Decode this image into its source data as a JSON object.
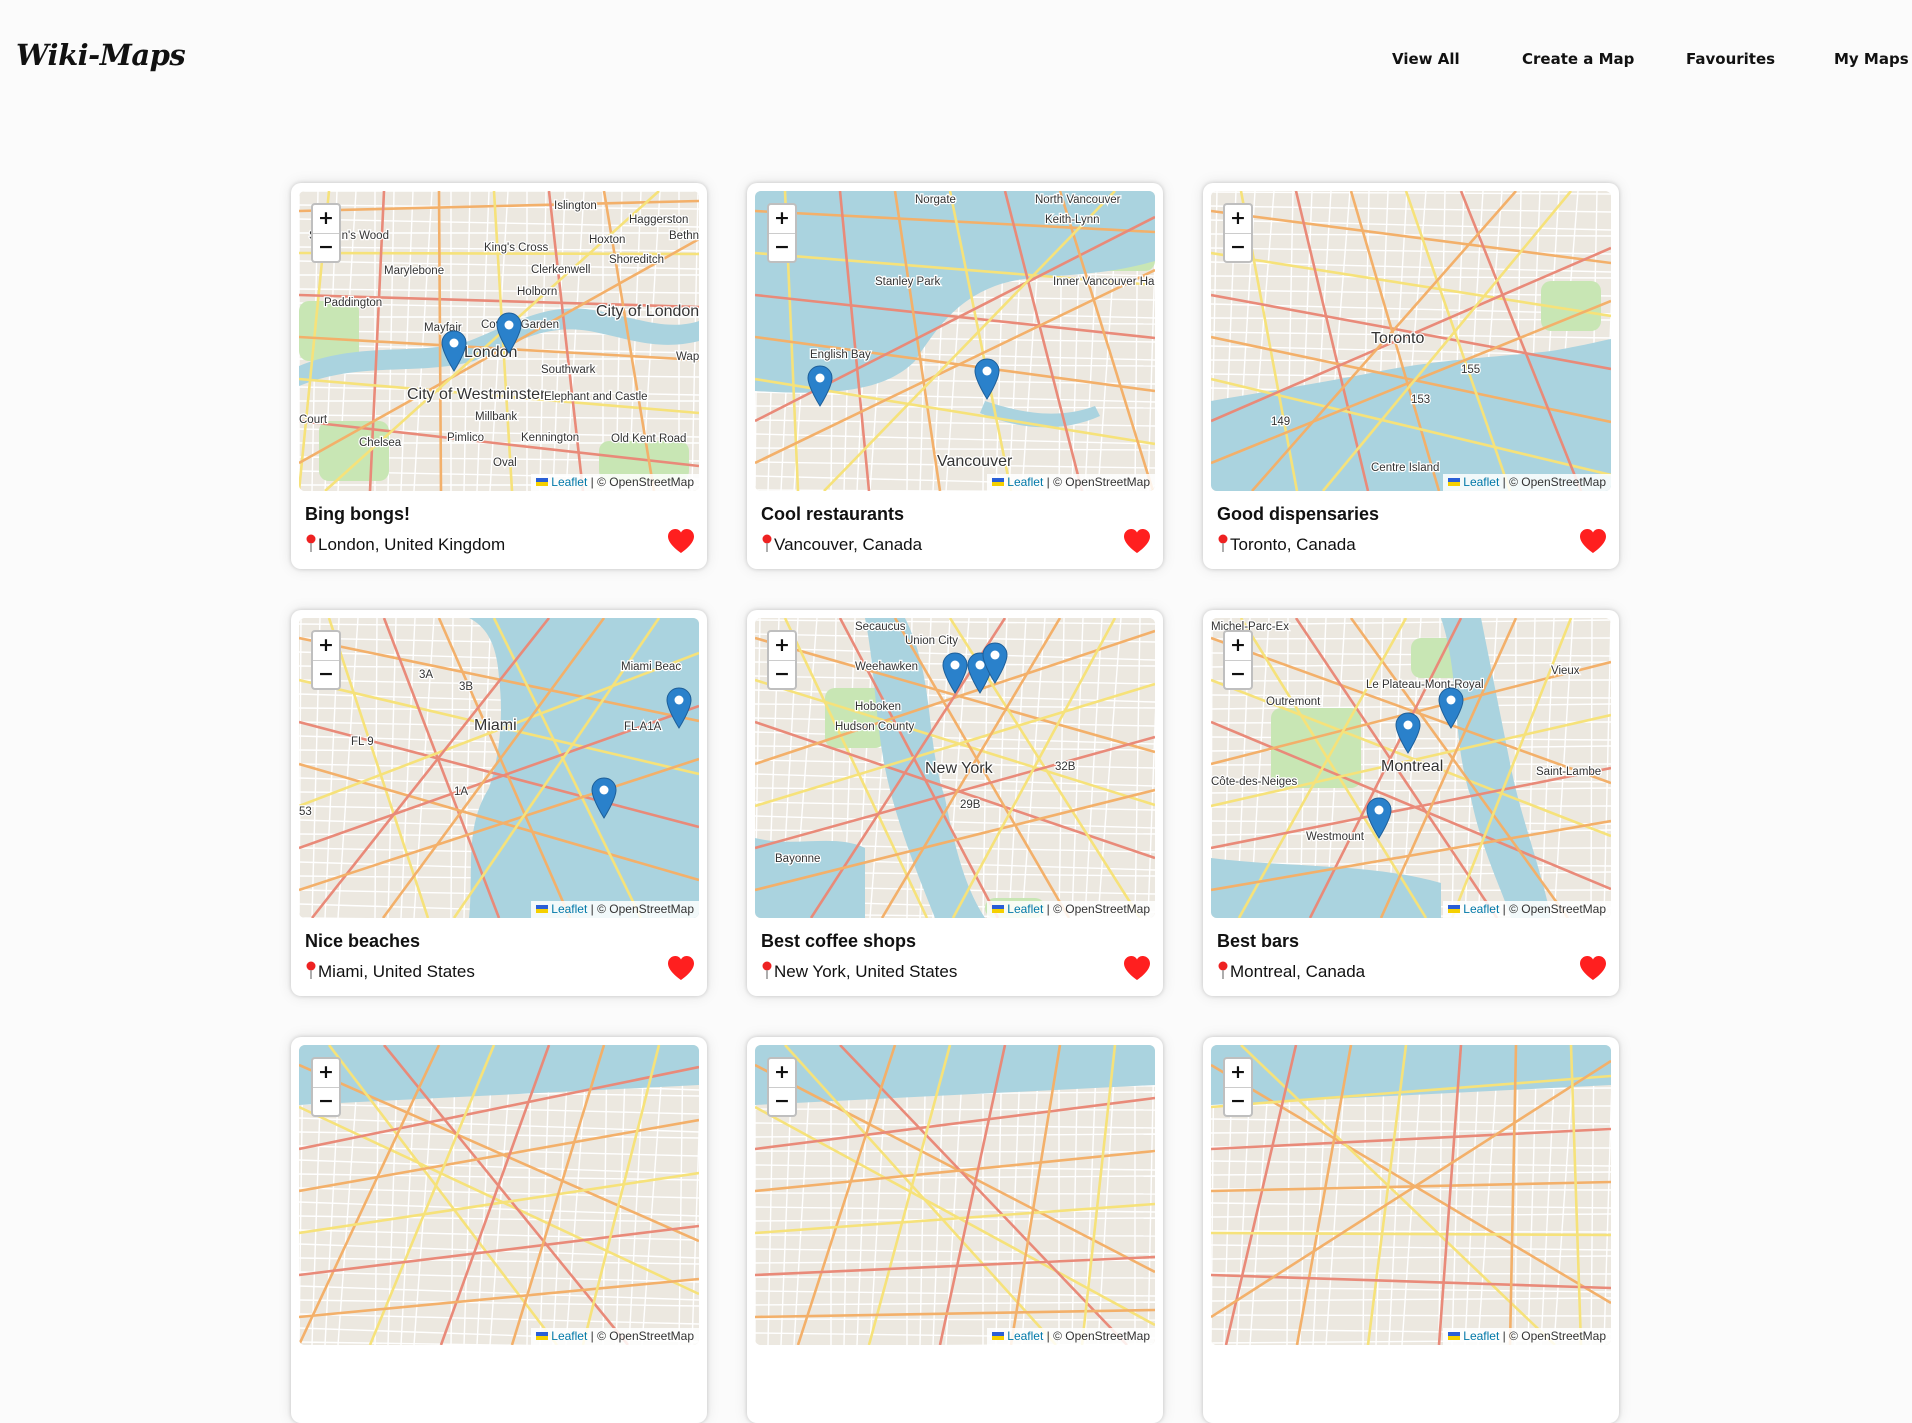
{
  "header": {
    "logo": "Wiki-Maps",
    "nav": [
      {
        "label": "View All"
      },
      {
        "label": "Create a Map"
      },
      {
        "label": "Favourites"
      },
      {
        "label": "My Maps"
      }
    ]
  },
  "map_common": {
    "zoom_in": "+",
    "zoom_out": "−",
    "attribution_link": "Leaflet",
    "attribution_text": "| © OpenStreetMap",
    "favourite_icon": "heart-icon",
    "location_icon": "red-pin-icon"
  },
  "colors": {
    "marker": "#2a81cb",
    "heart": "#ff1f1f",
    "water": "#aad3df",
    "park": "#c8e6b4",
    "land": "#ece8e0"
  },
  "cards": [
    {
      "title": "Bing bongs!",
      "location": "London, United Kingdom",
      "map_labels": [
        "Islington",
        "St John's Wood",
        "King's Cross",
        "Hoxton",
        "Haggerston",
        "Marylebone",
        "Clerkenwell",
        "Shoreditch",
        "Paddington",
        "Holborn",
        "City of London",
        "Mayfair",
        "Covent Garden",
        "London",
        "Southwark",
        "City of Westminster",
        "Elephant and Castle",
        "Millbank",
        "Chelsea",
        "Pimlico",
        "Kennington",
        "Old Kent Road",
        "Oval",
        "Court",
        "Bethn",
        "Wap"
      ]
    },
    {
      "title": "Cool restaurants",
      "location": "Vancouver, Canada",
      "map_labels": [
        "Norgate",
        "North Vancouver",
        "Keith-Lynn",
        "Stanley Park",
        "Inner Vancouver Harbour",
        "English Bay",
        "Vancouver"
      ]
    },
    {
      "title": "Good dispensaries",
      "location": "Toronto, Canada",
      "map_labels": [
        "Toronto",
        "Centre Island",
        "155",
        "153",
        "149"
      ]
    },
    {
      "title": "Nice beaches",
      "location": "Miami, United States",
      "map_labels": [
        "Miami Beac",
        "Miami",
        "FL 9",
        "FL A1A",
        "3A",
        "3B",
        "1A",
        "53"
      ]
    },
    {
      "title": "Best coffee shops",
      "location": "New York, United States",
      "map_labels": [
        "Secaucus",
        "Union City",
        "Weehawken",
        "Hoboken",
        "Hudson County",
        "New York",
        "Bayonne",
        "32B",
        "29B"
      ]
    },
    {
      "title": "Best bars",
      "location": "Montreal, Canada",
      "map_labels": [
        "Michel-Parc-Ex",
        "Le Plateau-Mont-Royal",
        "Outremont",
        "Montreal",
        "Côte-des-Neiges",
        "Westmount",
        "Saint-Lambe",
        "Vieux"
      ]
    }
  ]
}
